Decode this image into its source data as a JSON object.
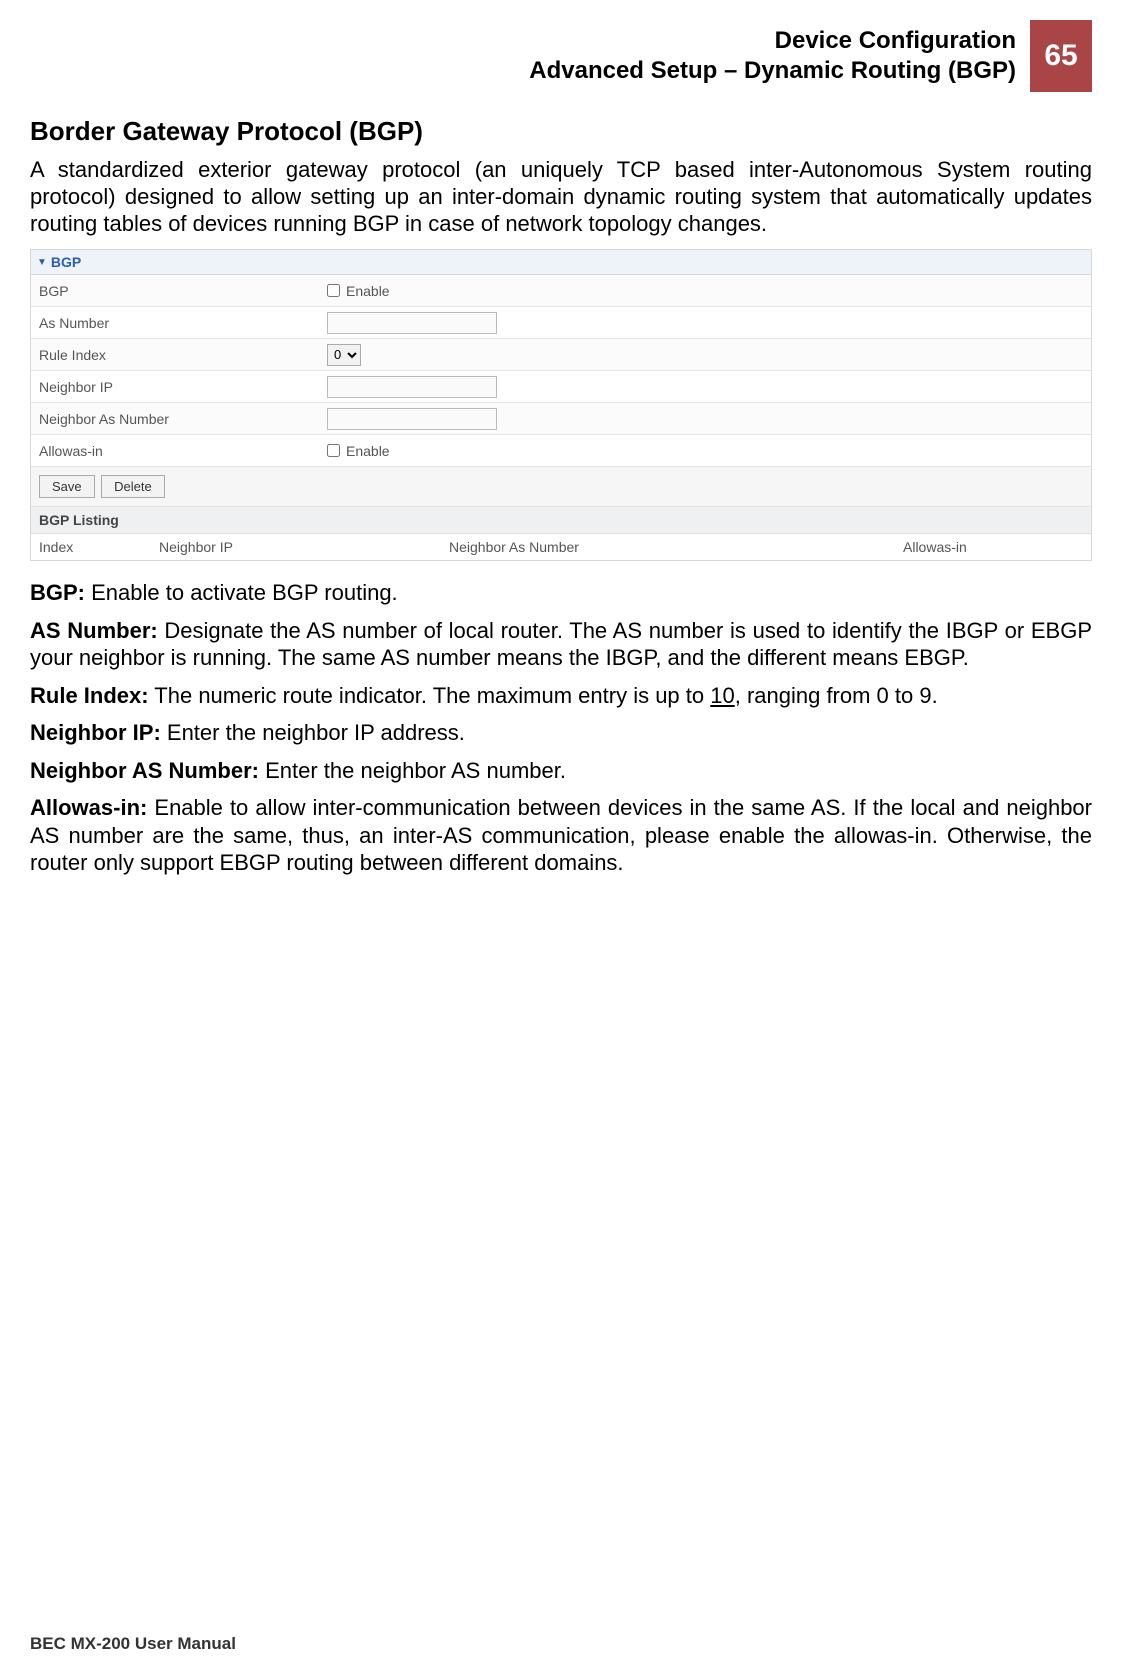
{
  "header": {
    "line1": "Device Configuration",
    "line2": "Advanced Setup – Dynamic Routing (BGP)",
    "page_number": "65"
  },
  "section": {
    "title": "Border Gateway Protocol (BGP)",
    "intro": "A standardized exterior gateway protocol (an uniquely TCP based inter-Autonomous System routing protocol) designed to allow setting up an inter-domain dynamic routing system that automatically updates routing tables of devices running BGP in case of network topology changes."
  },
  "ui": {
    "panel_title": "BGP",
    "rows": {
      "bgp_label": "BGP",
      "bgp_enable_text": "Enable",
      "as_number_label": "As Number",
      "rule_index_label": "Rule Index",
      "rule_index_value": "0",
      "neighbor_ip_label": "Neighbor IP",
      "neighbor_as_label": "Neighbor As Number",
      "allowas_label": "Allowas-in",
      "allowas_enable_text": "Enable"
    },
    "buttons": {
      "save": "Save",
      "delete": "Delete"
    },
    "listing": {
      "title": "BGP Listing",
      "col_index": "Index",
      "col_neighbor_ip": "Neighbor IP",
      "col_neighbor_as": "Neighbor As Number",
      "col_allowas": "Allowas-in"
    }
  },
  "descriptions": {
    "bgp_label": "BGP:",
    "bgp_text": " Enable to activate BGP routing.",
    "asnum_label": "AS Number:",
    "asnum_text": " Designate the AS number of local router. The AS number is used to identify the IBGP or EBGP your neighbor is running. The same AS number means the IBGP, and the different means EBGP.",
    "ruleidx_label": "Rule Index:",
    "ruleidx_pre": " The numeric route indicator. The maximum entry is up to ",
    "ruleidx_underlined": "10",
    "ruleidx_post": ", ranging from 0 to 9.",
    "neighip_label": "Neighbor IP:",
    "neighip_text": " Enter the neighbor IP address.",
    "neighas_label": "Neighbor AS Number:",
    "neighas_text": " Enter the neighbor AS number.",
    "allowas_label": "Allowas-in:",
    "allowas_text": " Enable to allow inter-communication between devices in the same AS. If the local and neighbor AS number are the same, thus, an inter-AS communication, please enable the allowas-in. Otherwise, the router only support EBGP routing between different domains."
  },
  "footer": "BEC MX-200 User Manual"
}
